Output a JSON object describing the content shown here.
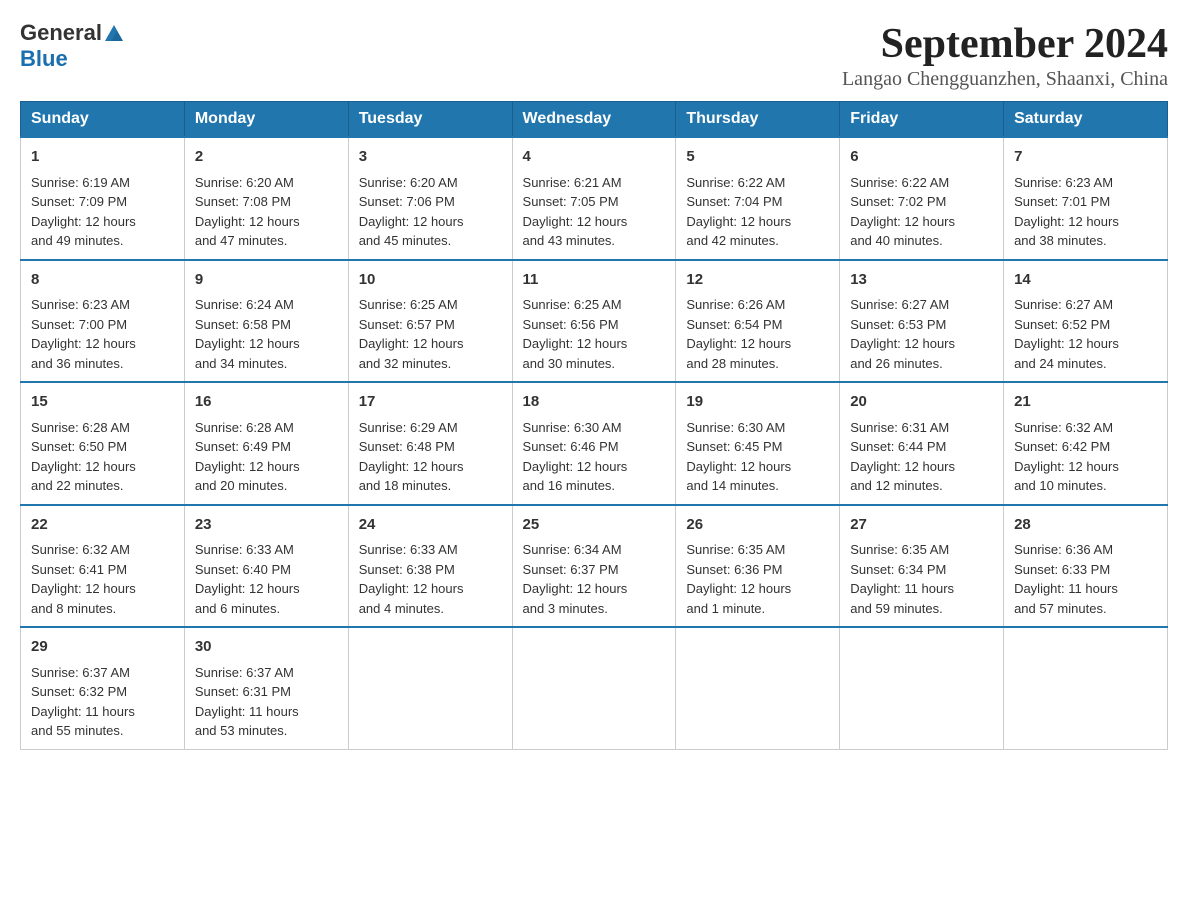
{
  "logo": {
    "general": "General",
    "blue": "Blue"
  },
  "title": "September 2024",
  "subtitle": "Langao Chengguanzhen, Shaanxi, China",
  "days_of_week": [
    "Sunday",
    "Monday",
    "Tuesday",
    "Wednesday",
    "Thursday",
    "Friday",
    "Saturday"
  ],
  "weeks": [
    [
      {
        "day": "1",
        "sunrise": "6:19 AM",
        "sunset": "7:09 PM",
        "daylight": "12 hours and 49 minutes."
      },
      {
        "day": "2",
        "sunrise": "6:20 AM",
        "sunset": "7:08 PM",
        "daylight": "12 hours and 47 minutes."
      },
      {
        "day": "3",
        "sunrise": "6:20 AM",
        "sunset": "7:06 PM",
        "daylight": "12 hours and 45 minutes."
      },
      {
        "day": "4",
        "sunrise": "6:21 AM",
        "sunset": "7:05 PM",
        "daylight": "12 hours and 43 minutes."
      },
      {
        "day": "5",
        "sunrise": "6:22 AM",
        "sunset": "7:04 PM",
        "daylight": "12 hours and 42 minutes."
      },
      {
        "day": "6",
        "sunrise": "6:22 AM",
        "sunset": "7:02 PM",
        "daylight": "12 hours and 40 minutes."
      },
      {
        "day": "7",
        "sunrise": "6:23 AM",
        "sunset": "7:01 PM",
        "daylight": "12 hours and 38 minutes."
      }
    ],
    [
      {
        "day": "8",
        "sunrise": "6:23 AM",
        "sunset": "7:00 PM",
        "daylight": "12 hours and 36 minutes."
      },
      {
        "day": "9",
        "sunrise": "6:24 AM",
        "sunset": "6:58 PM",
        "daylight": "12 hours and 34 minutes."
      },
      {
        "day": "10",
        "sunrise": "6:25 AM",
        "sunset": "6:57 PM",
        "daylight": "12 hours and 32 minutes."
      },
      {
        "day": "11",
        "sunrise": "6:25 AM",
        "sunset": "6:56 PM",
        "daylight": "12 hours and 30 minutes."
      },
      {
        "day": "12",
        "sunrise": "6:26 AM",
        "sunset": "6:54 PM",
        "daylight": "12 hours and 28 minutes."
      },
      {
        "day": "13",
        "sunrise": "6:27 AM",
        "sunset": "6:53 PM",
        "daylight": "12 hours and 26 minutes."
      },
      {
        "day": "14",
        "sunrise": "6:27 AM",
        "sunset": "6:52 PM",
        "daylight": "12 hours and 24 minutes."
      }
    ],
    [
      {
        "day": "15",
        "sunrise": "6:28 AM",
        "sunset": "6:50 PM",
        "daylight": "12 hours and 22 minutes."
      },
      {
        "day": "16",
        "sunrise": "6:28 AM",
        "sunset": "6:49 PM",
        "daylight": "12 hours and 20 minutes."
      },
      {
        "day": "17",
        "sunrise": "6:29 AM",
        "sunset": "6:48 PM",
        "daylight": "12 hours and 18 minutes."
      },
      {
        "day": "18",
        "sunrise": "6:30 AM",
        "sunset": "6:46 PM",
        "daylight": "12 hours and 16 minutes."
      },
      {
        "day": "19",
        "sunrise": "6:30 AM",
        "sunset": "6:45 PM",
        "daylight": "12 hours and 14 minutes."
      },
      {
        "day": "20",
        "sunrise": "6:31 AM",
        "sunset": "6:44 PM",
        "daylight": "12 hours and 12 minutes."
      },
      {
        "day": "21",
        "sunrise": "6:32 AM",
        "sunset": "6:42 PM",
        "daylight": "12 hours and 10 minutes."
      }
    ],
    [
      {
        "day": "22",
        "sunrise": "6:32 AM",
        "sunset": "6:41 PM",
        "daylight": "12 hours and 8 minutes."
      },
      {
        "day": "23",
        "sunrise": "6:33 AM",
        "sunset": "6:40 PM",
        "daylight": "12 hours and 6 minutes."
      },
      {
        "day": "24",
        "sunrise": "6:33 AM",
        "sunset": "6:38 PM",
        "daylight": "12 hours and 4 minutes."
      },
      {
        "day": "25",
        "sunrise": "6:34 AM",
        "sunset": "6:37 PM",
        "daylight": "12 hours and 3 minutes."
      },
      {
        "day": "26",
        "sunrise": "6:35 AM",
        "sunset": "6:36 PM",
        "daylight": "12 hours and 1 minute."
      },
      {
        "day": "27",
        "sunrise": "6:35 AM",
        "sunset": "6:34 PM",
        "daylight": "11 hours and 59 minutes."
      },
      {
        "day": "28",
        "sunrise": "6:36 AM",
        "sunset": "6:33 PM",
        "daylight": "11 hours and 57 minutes."
      }
    ],
    [
      {
        "day": "29",
        "sunrise": "6:37 AM",
        "sunset": "6:32 PM",
        "daylight": "11 hours and 55 minutes."
      },
      {
        "day": "30",
        "sunrise": "6:37 AM",
        "sunset": "6:31 PM",
        "daylight": "11 hours and 53 minutes."
      },
      null,
      null,
      null,
      null,
      null
    ]
  ],
  "labels": {
    "sunrise": "Sunrise:",
    "sunset": "Sunset:",
    "daylight": "Daylight:"
  }
}
